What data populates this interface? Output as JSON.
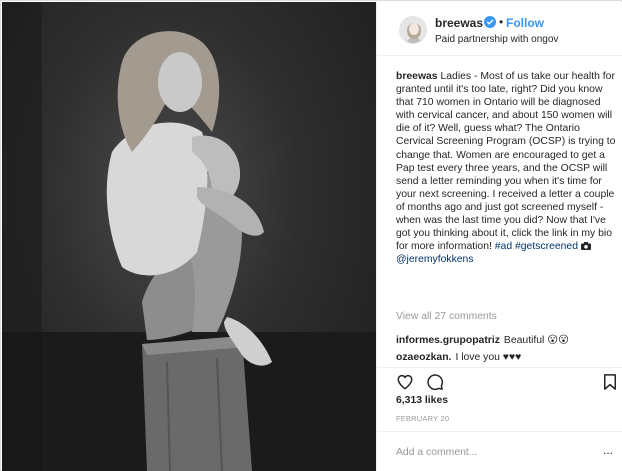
{
  "post": {
    "username": "breewas",
    "follow_label": "Follow",
    "dot": "•",
    "partnership": "Paid partnership with ongov",
    "caption": {
      "username": "breewas",
      "text": "Ladies - Most of us take our health for granted until it's too late, right? Did you know that 710 women in Ontario will be diagnosed with cervical cancer, and about 150 women will die of it? Well, guess what? The Ontario Cervical Screening Program (OCSP) is trying to change that. Women are encouraged to get a Pap test every three years, and the OCSP will send a letter reminding you when it's time for your next screening. I received a letter a couple of months ago and just got screened myself - when was the last time you did? Now that I've got you thinking about it, click the link in my bio for more information!",
      "tag_ad": "#ad",
      "tag_getscreened": "#getscreened",
      "photo_credit": "@jeremyfokkens"
    },
    "view_all": "View all 27 comments",
    "comments": [
      {
        "user": "informes.grupopatriz",
        "text": "Beautiful 😮😮"
      },
      {
        "user": "ozaeozkan.",
        "text": "I love you ♥♥♥"
      }
    ],
    "likes": "6,313 likes",
    "date": "FEBRUARY 20",
    "add_comment_placeholder": "Add a comment...",
    "more_label": "..."
  },
  "icons": {
    "heart": "heart-icon",
    "comment": "comment-icon",
    "bookmark": "bookmark-icon",
    "verified": "verified-badge-icon",
    "camera": "camera-icon"
  },
  "colors": {
    "link_blue": "#3897f0",
    "hashtag": "#003569",
    "muted": "#999999",
    "text": "#262626"
  }
}
